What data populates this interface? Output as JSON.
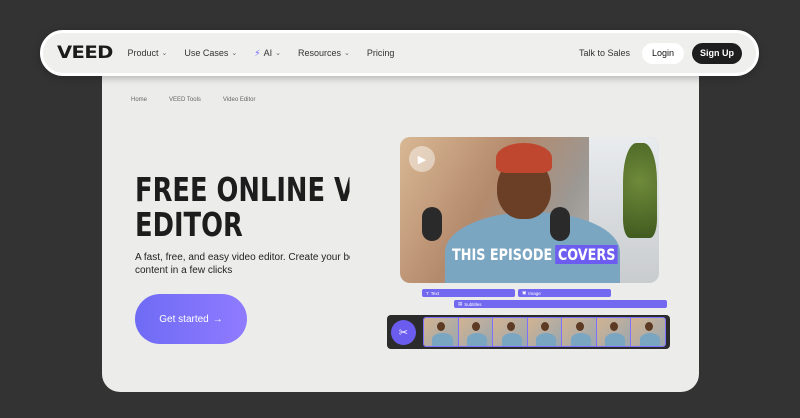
{
  "nav": {
    "logo": "VEED",
    "menu": [
      {
        "label": "Product",
        "has_dropdown": true
      },
      {
        "label": "Use Cases",
        "has_dropdown": true
      },
      {
        "label": "AI",
        "has_dropdown": true,
        "icon": "bolt-icon"
      },
      {
        "label": "Resources",
        "has_dropdown": true
      },
      {
        "label": "Pricing",
        "has_dropdown": false
      }
    ],
    "talk_to_sales": "Talk to Sales",
    "login": "Login",
    "signup": "Sign Up"
  },
  "breadcrumb": [
    "Home",
    "VEED Tools",
    "Video Editor"
  ],
  "hero": {
    "title_line1": "FREE ONLINE VIDEO",
    "title_line2": "EDITOR",
    "subtitle_line1": "A fast, free, and easy video editor. Create your best",
    "subtitle_line2": "content in a few clicks",
    "cta": "Get started",
    "cta_arrow": "→"
  },
  "preview": {
    "caption_plain": "THIS EPISODE",
    "caption_highlight": "COVERS",
    "tracks": {
      "text": "Text",
      "image": "Image",
      "subtitles": "Subtitles"
    }
  },
  "colors": {
    "accent": "#6b5cf0",
    "page_bg": "#333333",
    "card_bg": "#ececea",
    "dark_button": "#1e1e1e"
  }
}
